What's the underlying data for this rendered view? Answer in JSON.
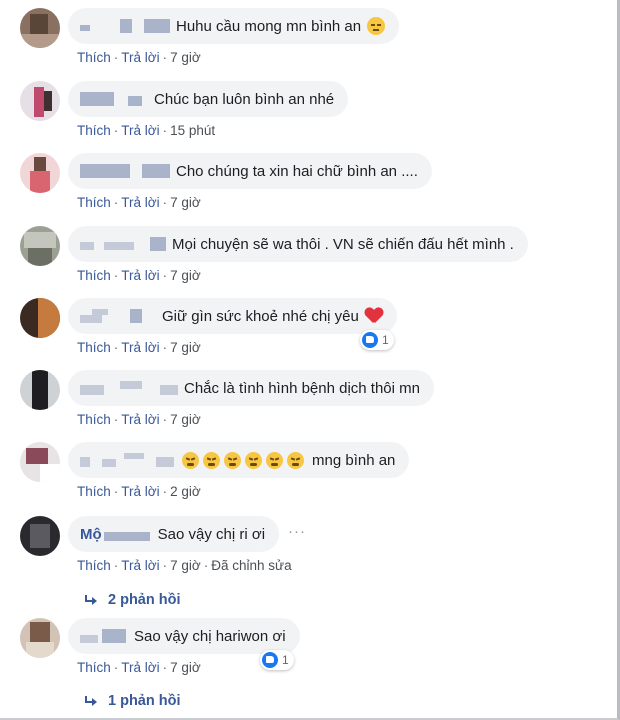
{
  "action_labels": {
    "like": "Thích",
    "reply": "Trả lời",
    "separator": "·"
  },
  "comments": [
    {
      "name_visible": "",
      "text": "Huhu cầu mong mn bình an",
      "emoji": "😔",
      "time": "7 giờ"
    },
    {
      "name_visible": "",
      "text": "Chúc bạn luôn bình an nhé",
      "time": "15 phút"
    },
    {
      "name_visible": "",
      "text": "Cho chúng ta xin hai chữ bình an ....",
      "time": "7 giờ"
    },
    {
      "name_visible": "",
      "text": "Mọi chuyện sẽ wa thôi . VN sẽ chiến đấu hết mình .",
      "time": "7 giờ"
    },
    {
      "name_visible": "",
      "text": "Giữ gìn sức khoẻ nhé chị yêu",
      "emoji": "❤️",
      "time": "7 giờ",
      "reaction": {
        "icon": "like-icon",
        "count": "1"
      }
    },
    {
      "name_visible": "",
      "text": "Chắc là tình hình bệnh dịch thôi mn",
      "time": "7 giờ"
    },
    {
      "name_visible": "",
      "text": "mng bình an",
      "emoji_count": 6,
      "time": "2 giờ"
    },
    {
      "name_visible": "Mộ",
      "text": "Sao vậy chị ri ơi",
      "time": "7 giờ",
      "edited": "Đã chỉnh sửa",
      "more": "···",
      "replies": "2 phản hồi"
    },
    {
      "name_visible": "",
      "text": "Sao vậy chị hariwon ơi",
      "time": "7 giờ",
      "reaction": {
        "icon": "like-icon",
        "count": "1"
      },
      "replies": "1 phản hồi"
    }
  ],
  "colors": {
    "link": "#385898",
    "bubble": "#f2f3f5",
    "like_blue": "#1877f2",
    "heart": "#e4313f"
  }
}
